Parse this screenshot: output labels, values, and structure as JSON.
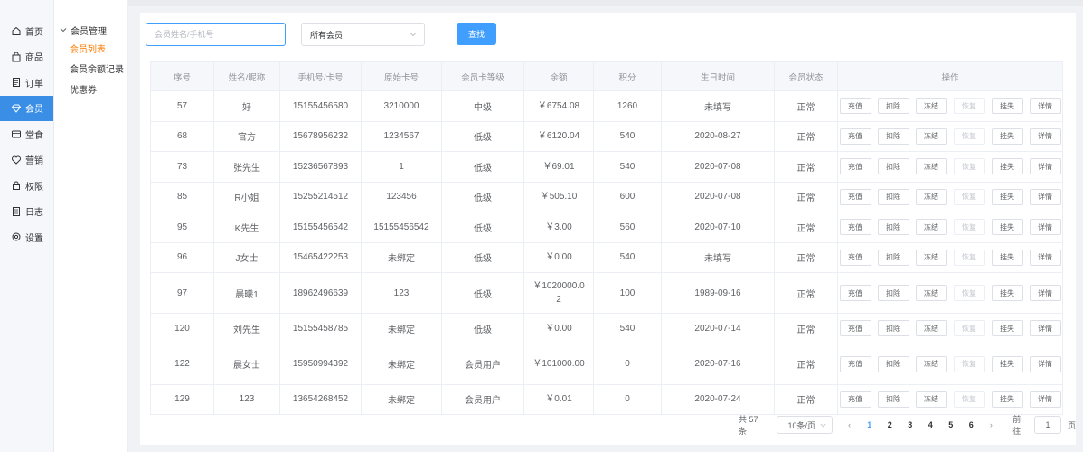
{
  "sidebar": {
    "items": [
      {
        "label": "首页",
        "icon": "home-icon",
        "active": false
      },
      {
        "label": "商品",
        "icon": "bag-icon",
        "active": false
      },
      {
        "label": "订单",
        "icon": "document-icon",
        "active": false
      },
      {
        "label": "会员",
        "icon": "diamond-icon",
        "active": true
      },
      {
        "label": "堂食",
        "icon": "dining-icon",
        "active": false
      },
      {
        "label": "营销",
        "icon": "heart-icon",
        "active": false
      },
      {
        "label": "权限",
        "icon": "lock-icon",
        "active": false
      },
      {
        "label": "日志",
        "icon": "log-icon",
        "active": false
      },
      {
        "label": "设置",
        "icon": "gear-icon",
        "active": false
      }
    ]
  },
  "subnav": {
    "header": "会员管理",
    "items": [
      {
        "label": "会员列表",
        "active": true
      },
      {
        "label": "会员余额记录",
        "active": false
      },
      {
        "label": "优惠券",
        "active": false
      }
    ]
  },
  "search": {
    "placeholder": "会员姓名/手机号",
    "value": "",
    "filter_selected": "所有会员",
    "button_label": "查找"
  },
  "table": {
    "headers": [
      "序号",
      "姓名/昵称",
      "手机号/卡号",
      "原始卡号",
      "会员卡等级",
      "余额",
      "积分",
      "生日时间",
      "会员状态",
      "操作"
    ],
    "actions": [
      "充值",
      "扣除",
      "冻结",
      "恢复",
      "挂失",
      "详情"
    ],
    "disabled_action": "恢复",
    "rows": [
      [
        "57",
        "好",
        "15155456580",
        "3210000",
        "中级",
        "￥6754.08",
        "1260",
        "未填写",
        "正常"
      ],
      [
        "68",
        "官方",
        "15678956232",
        "1234567",
        "低级",
        "￥6120.04",
        "540",
        "2020-08-27",
        "正常"
      ],
      [
        "73",
        "张先生",
        "15236567893",
        "1",
        "低级",
        "￥69.01",
        "540",
        "2020-07-08",
        "正常"
      ],
      [
        "85",
        "R小姐",
        "15255214512",
        "123456",
        "低级",
        "￥505.10",
        "600",
        "2020-07-08",
        "正常"
      ],
      [
        "95",
        "K先生",
        "15155456542",
        "15155456542",
        "低级",
        "￥3.00",
        "560",
        "2020-07-10",
        "正常"
      ],
      [
        "96",
        "J女士",
        "15465422253",
        "未绑定",
        "低级",
        "￥0.00",
        "540",
        "未填写",
        "正常"
      ],
      [
        "97",
        "晨曦1",
        "18962496639",
        "123",
        "低级",
        "￥1020000.02",
        "100",
        "1989-09-16",
        "正常"
      ],
      [
        "120",
        "刘先生",
        "15155458785",
        "未绑定",
        "低级",
        "￥0.00",
        "540",
        "2020-07-14",
        "正常"
      ],
      [
        "122",
        "晨女士",
        "15950994392",
        "未绑定",
        "会员用户",
        "￥101000.00",
        "0",
        "2020-07-16",
        "正常"
      ],
      [
        "129",
        "123",
        "13654268452",
        "未绑定",
        "会员用户",
        "￥0.01",
        "0",
        "2020-07-24",
        "正常"
      ]
    ]
  },
  "pagination": {
    "total_text": "共 57 条",
    "page_size": "10条/页",
    "prev": "‹",
    "next": "›",
    "pages": [
      "1",
      "2",
      "3",
      "4",
      "5",
      "6"
    ],
    "current_page": "1",
    "goto_label": "前往",
    "goto_value": "1",
    "goto_suffix": "页"
  },
  "colors": {
    "accent": "#409eff",
    "sidebar_active": "#3a8ee6",
    "submenu_active": "#ff7a00"
  }
}
